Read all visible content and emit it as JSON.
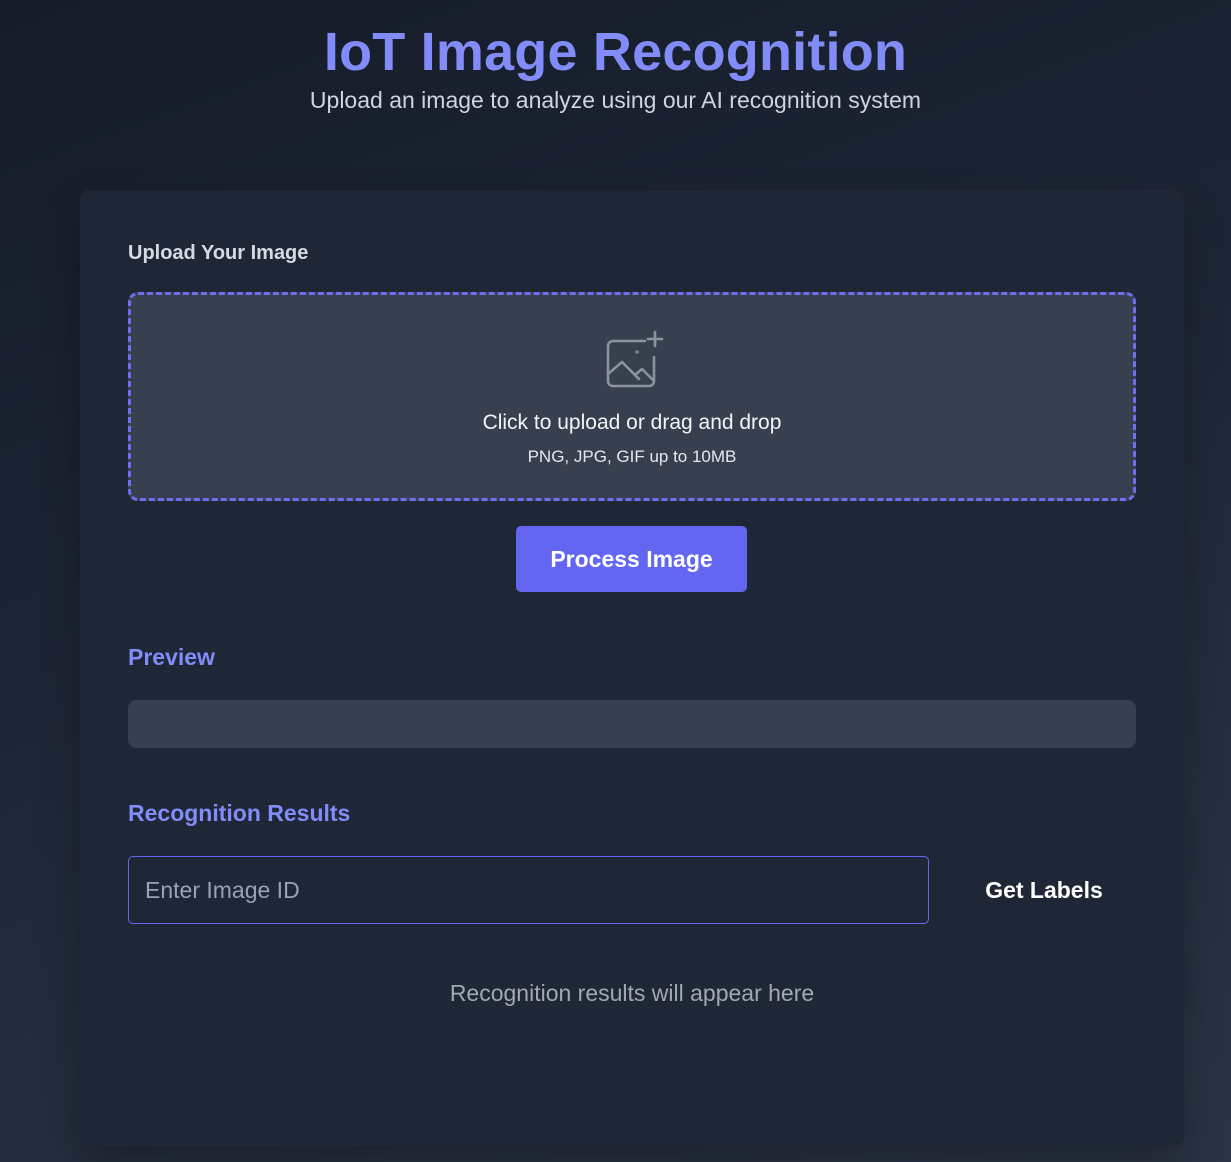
{
  "header": {
    "title": "IoT Image Recognition",
    "subtitle": "Upload an image to analyze using our AI recognition system"
  },
  "upload": {
    "label": "Upload Your Image",
    "icon": "image-plus-icon",
    "prompt": "Click to upload or drag and drop",
    "hint": "PNG, JPG, GIF up to 10MB",
    "process_label": "Process Image"
  },
  "preview": {
    "title": "Preview"
  },
  "results": {
    "title": "Recognition Results",
    "input_placeholder": "Enter Image ID",
    "input_value": "",
    "button_label": "Get Labels",
    "empty_text": "Recognition results will appear here"
  },
  "colors": {
    "accent": "#818cf8",
    "primary_button": "#6366f1",
    "card_background": "#1f2737",
    "dropzone_background": "#384050"
  }
}
